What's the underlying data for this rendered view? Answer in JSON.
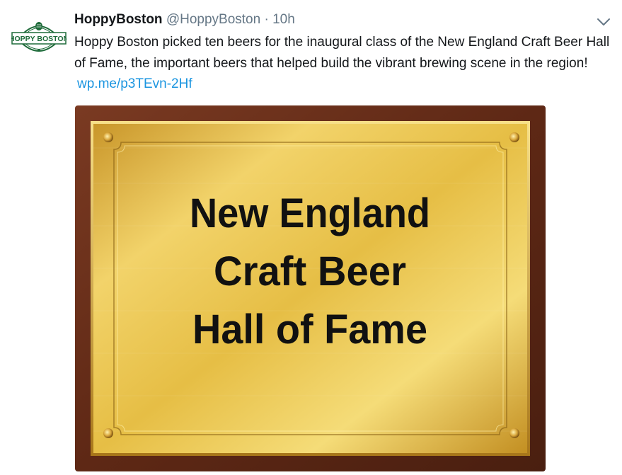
{
  "tweet": {
    "display_name": "HoppyBoston",
    "handle": "@HoppyBoston",
    "separator": "·",
    "time": "10h",
    "text": "Hoppy Boston picked ten beers for the inaugural class of the New England Craft Beer Hall of Fame, the important beers that helped build the vibrant brewing scene in the region!",
    "link": "wp.me/p3TEvn-2Hf"
  },
  "avatar": {
    "logo_text": "HOPPY BOSTON"
  },
  "media": {
    "plaque_lines": [
      "New England",
      "Craft Beer",
      "Hall of Fame"
    ]
  },
  "colors": {
    "link": "#1b95e0",
    "secondary_text": "#657786",
    "primary_text": "#14171a",
    "avatar_green": "#1e6b3a",
    "plaque_gold": "#e1b63c",
    "plaque_wood": "#6b2f1a"
  }
}
